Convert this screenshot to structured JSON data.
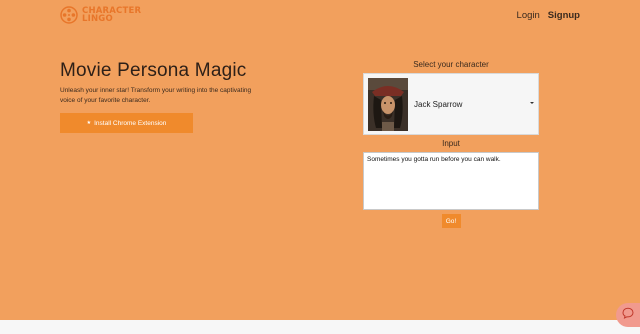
{
  "brand": {
    "name_line1": "CHARACTER",
    "name_line2": "LINGO",
    "accent_color": "#e8762a",
    "icon": "film-reel-icon"
  },
  "nav": {
    "login_label": "Login",
    "signup_label": "Signup"
  },
  "hero": {
    "title": "Movie Persona Magic",
    "subtitle": "Unleash your inner star! Transform your writing into the captivating voice of your favorite character.",
    "cta_label": "Install Chrome Extension",
    "cta_icon": "star-icon"
  },
  "character_selector": {
    "label": "Select your character",
    "selected_name": "Jack Sparrow",
    "avatar_icon": "character-portrait"
  },
  "input": {
    "label": "Input",
    "value": "Sometimes you gotta run before you can walk."
  },
  "go_label": "Go!",
  "colors": {
    "background": "#f2a05d",
    "button": "#f08a2c"
  },
  "chat": {
    "icon": "chat-bubble-icon"
  }
}
